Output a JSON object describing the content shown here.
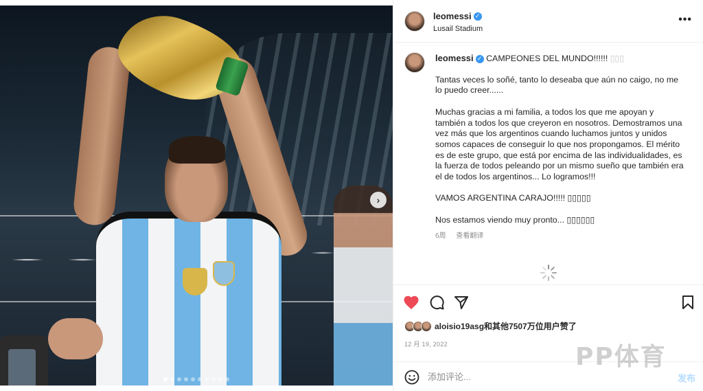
{
  "post": {
    "username": "leomessi",
    "location": "Lusail Stadium",
    "caption_title": "CAMPEONES DEL MUNDO!!!!!! ",
    "caption_title_emoji": "▯▯▯",
    "paragraphs": [
      "Tantas veces lo soñé, tanto lo deseaba que aún no caigo, no me lo puedo creer......",
      "Muchas gracias a mi familia, a todos los que me apoyan y también a todos los que creyeron en nosotros. Demostramos una vez más que los argentinos cuando luchamos juntos y unidos somos capaces de conseguir lo que nos propongamos. El mérito es de este grupo, que está por encima de las individualidades, es la fuerza de todos peleando por un mismo sueño que también era el de todos los argentinos... Lo logramos!!!",
      "VAMOS ARGENTINA CARAJO!!!!! ▯▯▯▯▯",
      "Nos estamos viendo muy pronto... ▯▯▯▯▯▯"
    ],
    "age": "6周",
    "translate": "查看翻译"
  },
  "likes": {
    "text": "aloisio19asg和其他7507万位用户赞了"
  },
  "date": "12 月 19, 2022",
  "comment": {
    "placeholder": "添加评论...",
    "post_label": "发布"
  },
  "carousel": {
    "next_symbol": "›",
    "dot_count": 10,
    "active_dot": 0
  },
  "watermark": "PP体育",
  "colors": {
    "like_red": "#ed4956",
    "verified_blue": "#3897f0",
    "post_button": "#b3dbff"
  },
  "icons": {
    "more": "more-options-icon",
    "like": "heart-icon",
    "comment": "comment-icon",
    "share": "send-icon",
    "save": "bookmark-icon",
    "emoji": "emoji-icon",
    "loading": "spinner-icon"
  }
}
